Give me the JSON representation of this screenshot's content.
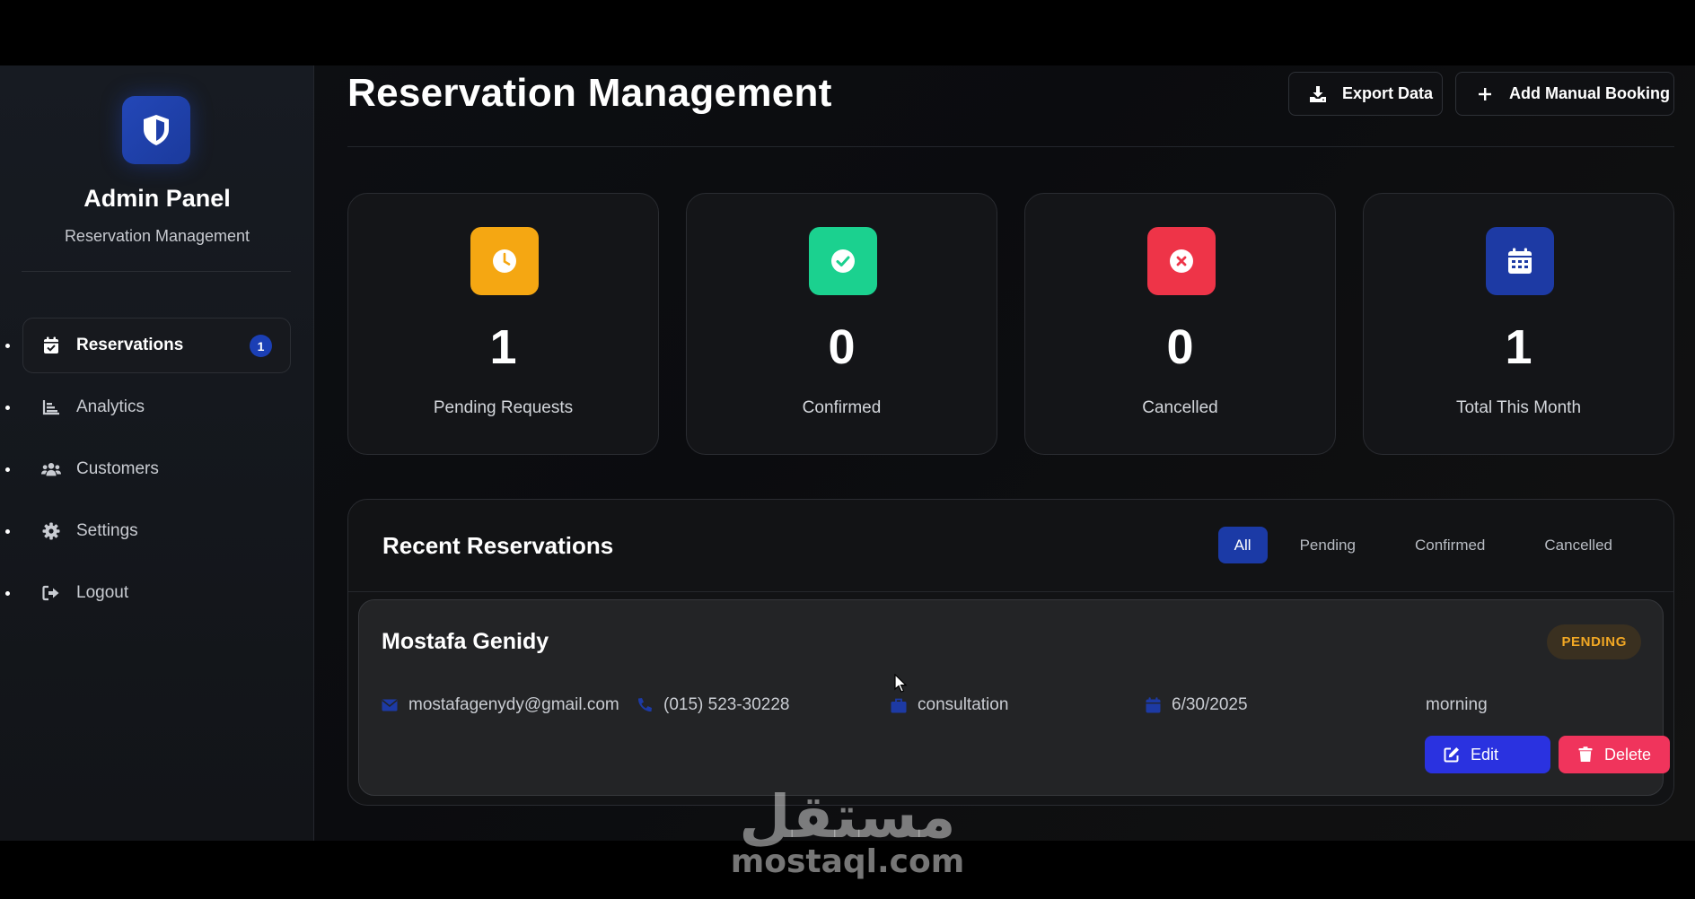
{
  "sidebar": {
    "brand_title": "Admin Panel",
    "brand_subtitle": "Reservation Management",
    "items": [
      {
        "label": "Reservations",
        "icon": "calendar-check-icon",
        "active": true,
        "badge": "1"
      },
      {
        "label": "Analytics",
        "icon": "bar-chart-icon",
        "active": false
      },
      {
        "label": "Customers",
        "icon": "users-icon",
        "active": false
      },
      {
        "label": "Settings",
        "icon": "gear-icon",
        "active": false
      },
      {
        "label": "Logout",
        "icon": "logout-icon",
        "active": false
      }
    ]
  },
  "header": {
    "title": "Reservation Management",
    "export_label": "Export Data",
    "add_label": "Add Manual Booking"
  },
  "stats": [
    {
      "value": "1",
      "label": "Pending Requests",
      "icon": "clock-icon",
      "color": "#f5a712"
    },
    {
      "value": "0",
      "label": "Confirmed",
      "icon": "check-circle-icon",
      "color": "#1bd18f"
    },
    {
      "value": "0",
      "label": "Cancelled",
      "icon": "x-circle-icon",
      "color": "#ee3448"
    },
    {
      "value": "1",
      "label": "Total This Month",
      "icon": "calendar-icon",
      "color": "#1d3aa4"
    }
  ],
  "reservations_panel": {
    "title": "Recent Reservations",
    "filters": [
      "All",
      "Pending",
      "Confirmed",
      "Cancelled"
    ],
    "active_filter": "All"
  },
  "reservation": {
    "name": "Mostafa Genidy",
    "status": "PENDING",
    "email": "mostafagenydy@gmail.com",
    "phone": "(015) 523-30228",
    "service": "consultation",
    "date": "6/30/2025",
    "time": "morning",
    "edit_label": "Edit",
    "delete_label": "Delete"
  },
  "watermark": {
    "arabic": "مستقل",
    "latin": "mostaql.com"
  }
}
